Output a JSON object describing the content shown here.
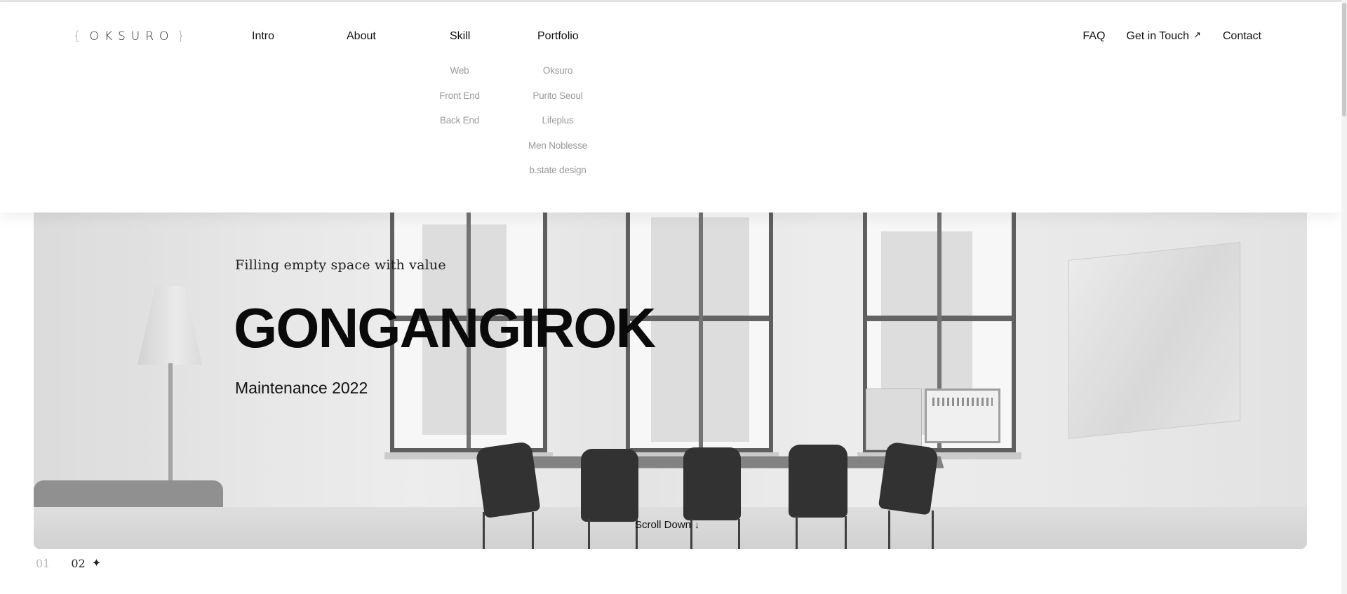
{
  "brand": {
    "logo_text": "OKSURO",
    "brace_left": "{",
    "brace_right": "}"
  },
  "nav": {
    "intro": "Intro",
    "about": "About",
    "skill": {
      "label": "Skill",
      "items": [
        "Web",
        "Front End",
        "Back End"
      ]
    },
    "portfolio": {
      "label": "Portfolio",
      "items": [
        "Oksuro",
        "Purito Seoul",
        "Lifeplus",
        "Men Noblesse",
        "b.state design"
      ]
    },
    "faq": "FAQ",
    "get_in_touch": "Get in Touch",
    "contact": "Contact"
  },
  "hero": {
    "subtitle": "Filling empty space with value",
    "title": "GONGANGIROK",
    "caption": "Maintenance 2022",
    "scroll_down": "Scroll Down"
  },
  "pagination": {
    "pages": [
      "01",
      "02"
    ],
    "active_index": 1
  },
  "icons": {
    "get_in_touch": "arrow-up-right-icon",
    "scroll_down": "arrow-down-icon",
    "pagination": "four-point-star-icon"
  },
  "colors": {
    "text": "#111111",
    "muted": "#9a9a9a",
    "background": "#ffffff"
  }
}
